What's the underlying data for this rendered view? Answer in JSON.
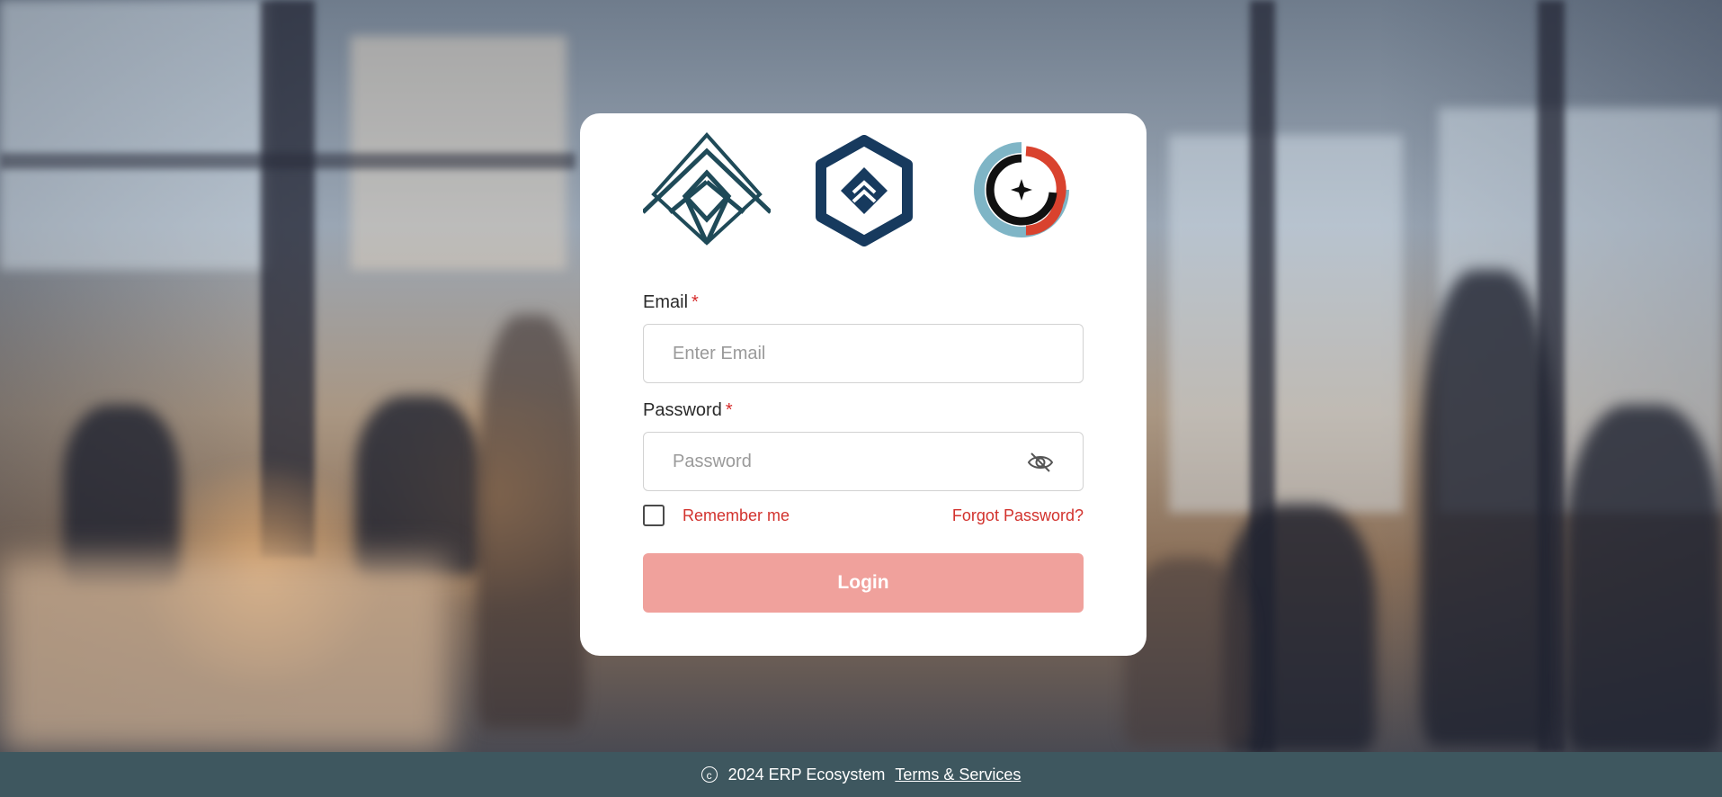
{
  "logos": {
    "first": "diamond-lattice-logo",
    "second": "hexagon-chevron-logo",
    "third": "swirl-star-logo"
  },
  "form": {
    "email_label": "Email",
    "email_required": "*",
    "email_placeholder": "Enter Email",
    "email_value": "",
    "password_label": "Password",
    "password_required": "*",
    "password_placeholder": "Password",
    "password_value": "",
    "remember_label": "Remember me",
    "remember_checked": false,
    "forgot_label": "Forgot Password?",
    "login_label": "Login"
  },
  "footer": {
    "copyright_symbol": "c",
    "text": "2024 ERP Ecosystem",
    "terms_label": "Terms & Services"
  },
  "colors": {
    "accent": "#d2322d",
    "login_button": "#f0a19c",
    "footer_bg": "#3e575f",
    "logo_teal": "#1f4a58",
    "logo_navy": "#173a5e"
  },
  "icons": {
    "password_toggle": "eye-slash-icon",
    "copyright": "copyright-icon"
  }
}
